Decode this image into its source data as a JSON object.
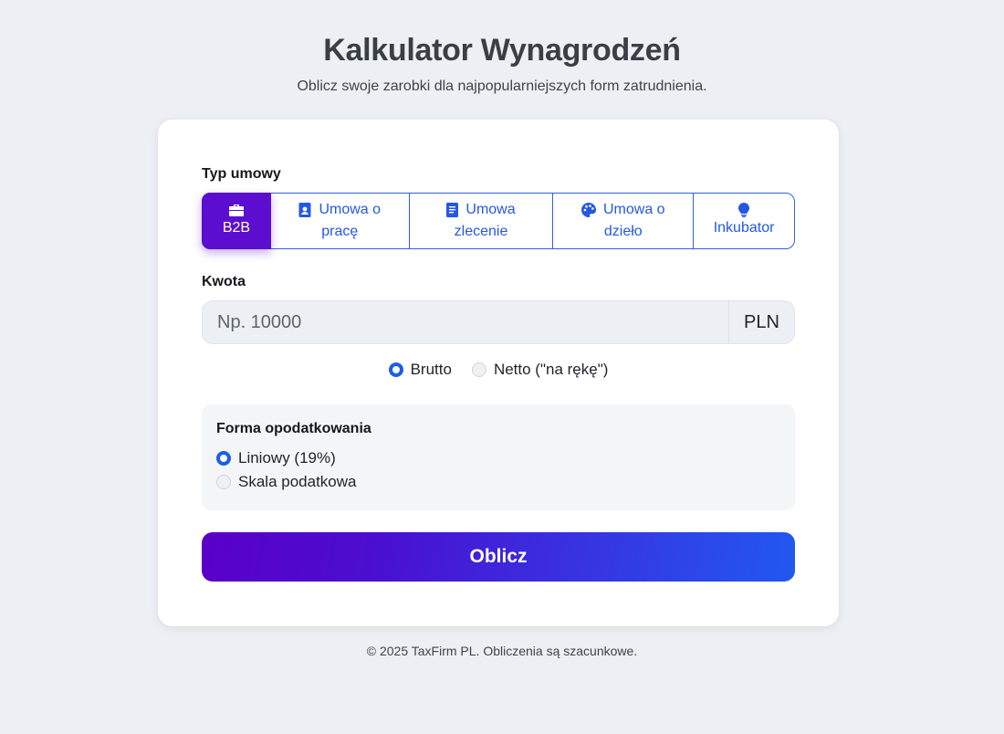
{
  "header": {
    "title": "Kalkulator Wynagrodzeń",
    "subtitle": "Oblicz swoje zarobki dla najpopularniejszych form zatrudnienia."
  },
  "contract": {
    "label": "Typ umowy",
    "tabs": [
      {
        "line1": "",
        "line2": "B2B",
        "icon": "briefcase-icon",
        "active": true
      },
      {
        "line1": "Umowa o",
        "line2": "pracę",
        "icon": "id-badge-icon",
        "active": false
      },
      {
        "line1": "Umowa",
        "line2": "zlecenie",
        "icon": "document-icon",
        "active": false
      },
      {
        "line1": "Umowa o",
        "line2": "dzieło",
        "icon": "palette-icon",
        "active": false
      },
      {
        "line1": "",
        "line2": "Inkubator",
        "icon": "lightbulb-icon",
        "active": false
      }
    ]
  },
  "amount": {
    "label": "Kwota",
    "placeholder": "Np. 10000",
    "value": "",
    "currency": "PLN"
  },
  "mode": {
    "options": [
      "Brutto",
      "Netto (\"na rękę\")"
    ],
    "selected": "Brutto"
  },
  "tax": {
    "label": "Forma opodatkowania",
    "options": [
      "Liniowy (19%)",
      "Skala podatkowa"
    ],
    "selected": "Liniowy (19%)"
  },
  "submit_label": "Oblicz",
  "footer": "© 2025 TaxFirm PL. Obliczenia są szacunkowe.",
  "colors": {
    "accent": "#2557e6",
    "active_tab": "#5b0ecf",
    "background": "#eceff3"
  }
}
